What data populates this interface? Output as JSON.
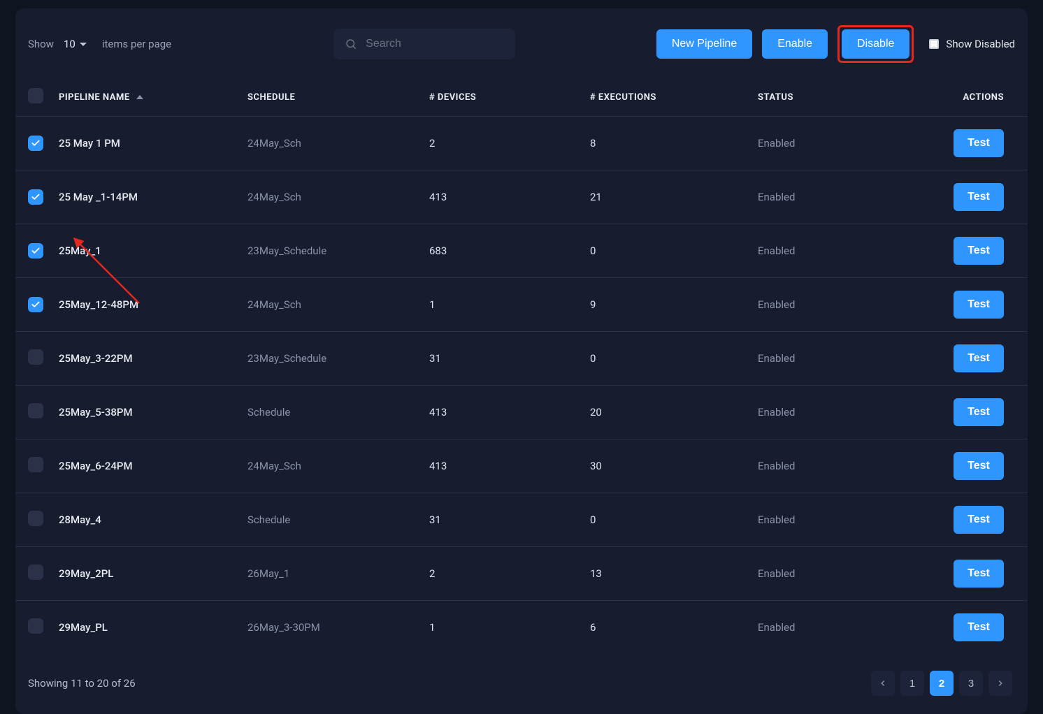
{
  "toolbar": {
    "show_label": "Show",
    "page_size": "10",
    "items_label": "items per page",
    "search_placeholder": "Search",
    "new_pipeline": "New Pipeline",
    "enable": "Enable",
    "disable": "Disable",
    "show_disabled_label": "Show Disabled"
  },
  "columns": {
    "name": "PIPELINE NAME",
    "schedule": "SCHEDULE",
    "devices": "# DEVICES",
    "executions": "# EXECUTIONS",
    "status": "STATUS",
    "actions": "ACTIONS"
  },
  "rows": [
    {
      "checked": true,
      "name": "25 May 1 PM",
      "schedule": "24May_Sch",
      "devices": "2",
      "executions": "8",
      "status": "Enabled",
      "action": "Test"
    },
    {
      "checked": true,
      "name": "25 May _1-14PM",
      "schedule": "24May_Sch",
      "devices": "413",
      "executions": "21",
      "status": "Enabled",
      "action": "Test"
    },
    {
      "checked": true,
      "name": "25May_1",
      "schedule": "23May_Schedule",
      "devices": "683",
      "executions": "0",
      "status": "Enabled",
      "action": "Test"
    },
    {
      "checked": true,
      "name": "25May_12-48PM",
      "schedule": "24May_Sch",
      "devices": "1",
      "executions": "9",
      "status": "Enabled",
      "action": "Test"
    },
    {
      "checked": false,
      "name": "25May_3-22PM",
      "schedule": "23May_Schedule",
      "devices": "31",
      "executions": "0",
      "status": "Enabled",
      "action": "Test"
    },
    {
      "checked": false,
      "name": "25May_5-38PM",
      "schedule": "Schedule",
      "devices": "413",
      "executions": "20",
      "status": "Enabled",
      "action": "Test"
    },
    {
      "checked": false,
      "name": "25May_6-24PM",
      "schedule": "24May_Sch",
      "devices": "413",
      "executions": "30",
      "status": "Enabled",
      "action": "Test"
    },
    {
      "checked": false,
      "name": "28May_4",
      "schedule": "Schedule",
      "devices": "31",
      "executions": "0",
      "status": "Enabled",
      "action": "Test"
    },
    {
      "checked": false,
      "name": "29May_2PL",
      "schedule": "26May_1",
      "devices": "2",
      "executions": "13",
      "status": "Enabled",
      "action": "Test"
    },
    {
      "checked": false,
      "name": "29May_PL",
      "schedule": "26May_3-30PM",
      "devices": "1",
      "executions": "6",
      "status": "Enabled",
      "action": "Test"
    }
  ],
  "footer": {
    "showing": "Showing 11 to 20 of 26"
  },
  "pagination": {
    "pages": [
      "1",
      "2",
      "3"
    ],
    "active": "2"
  }
}
